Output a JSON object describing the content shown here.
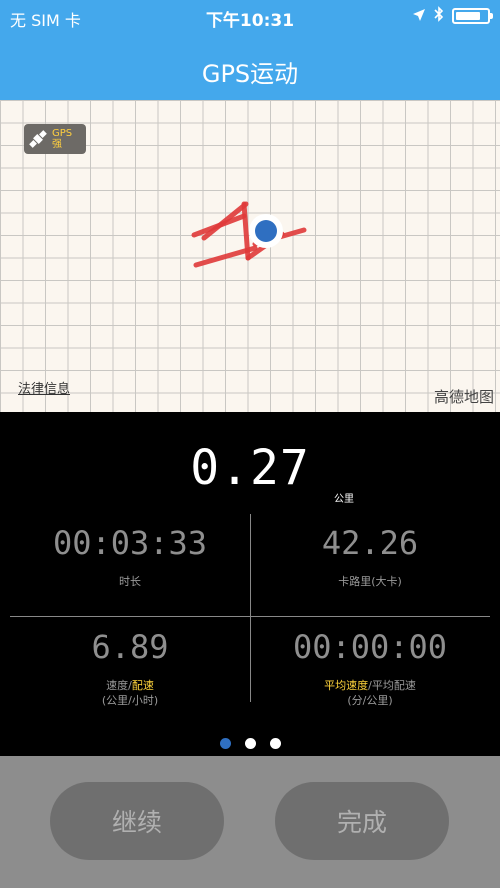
{
  "status_bar": {
    "carrier": "无 SIM 卡",
    "time": "下午10:31",
    "icons": [
      "location-arrow-icon",
      "bluetooth-icon",
      "battery-icon"
    ],
    "battery_fraction": 0.8
  },
  "nav": {
    "title": "GPS运动"
  },
  "map": {
    "gps_badge_line1": "GPS",
    "gps_badge_line2": "强",
    "legal_link": "法律信息",
    "brand": "高德地图",
    "track_color": "#e03a3a",
    "location_color": "#2f6fc1"
  },
  "stats": {
    "distance": "0.27",
    "distance_unit": "公里",
    "duration": {
      "value": "00:03:33",
      "label": "时长"
    },
    "calories": {
      "value": "42.26",
      "label": "卡路里(大卡)"
    },
    "speed": {
      "value": "6.89",
      "label_a": "速度",
      "label_sep": "/",
      "label_b": "配速",
      "sub": "(公里/小时)"
    },
    "pace": {
      "value": "00:00:00",
      "label_a": "平均速度",
      "label_sep": "/",
      "label_b": "平均配速",
      "sub": "(分/公里)"
    },
    "highlight_color": "#ffd43b",
    "page_indicator": {
      "count": 3,
      "active": 0
    }
  },
  "buttons": {
    "continue": "继续",
    "finish": "完成"
  }
}
